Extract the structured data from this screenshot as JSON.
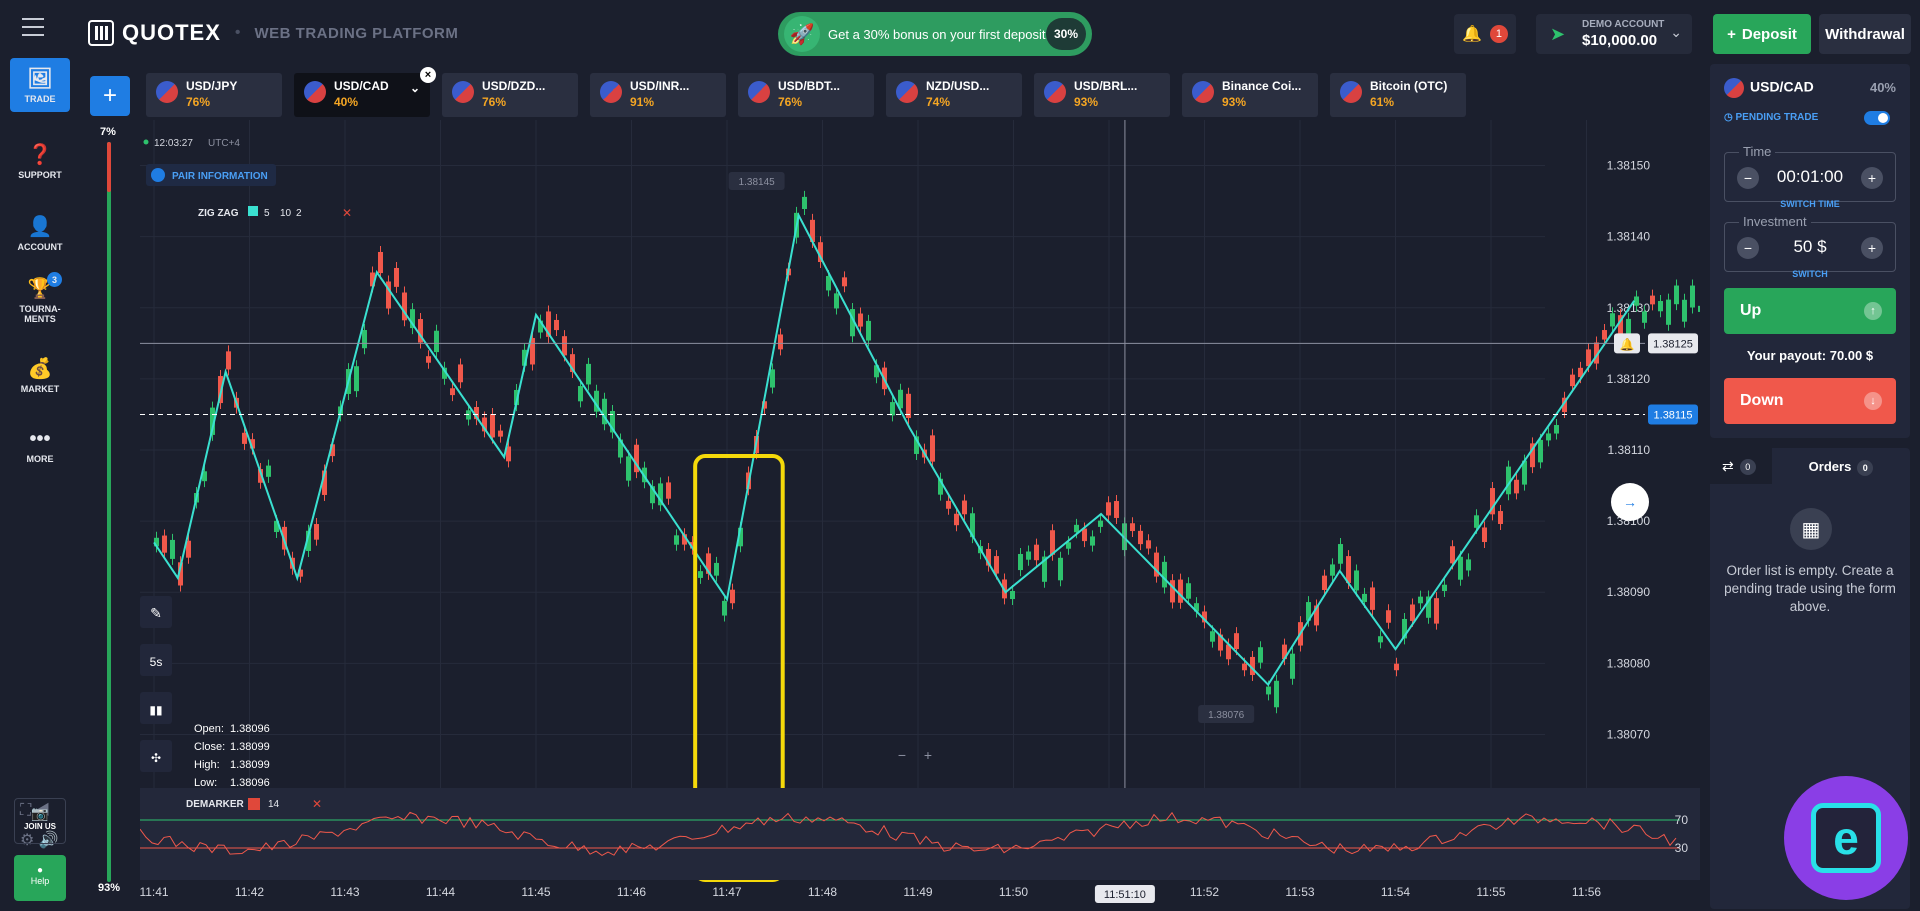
{
  "header": {
    "logo": "QUOTEX",
    "subtitle": "WEB TRADING PLATFORM",
    "bonus_text": "Get a 30% bonus on your first deposit",
    "bonus_pct": "30%",
    "notif_count": "1",
    "account_label": "DEMO ACCOUNT",
    "account_balance": "$10,000.00",
    "deposit": "Deposit",
    "withdrawal": "Withdrawal"
  },
  "sidebar": {
    "items": [
      {
        "label": "TRADE",
        "icon": "chart-icon"
      },
      {
        "label": "SUPPORT",
        "icon": "help-icon"
      },
      {
        "label": "ACCOUNT",
        "icon": "user-icon"
      },
      {
        "label": "TOURNA-MENTS",
        "icon": "trophy-icon",
        "badge": "3"
      },
      {
        "label": "MARKET",
        "icon": "coins-icon"
      },
      {
        "label": "MORE",
        "icon": "dots-icon"
      }
    ],
    "join_label": "JOIN US",
    "help_label": "Help"
  },
  "sentiment": {
    "top": "7%",
    "bottom": "93%",
    "up_fraction": 0.93
  },
  "tabs": [
    {
      "name": "USD/JPY",
      "pct": "76%"
    },
    {
      "name": "USD/CAD",
      "pct": "40%",
      "active": true
    },
    {
      "name": "USD/DZD...",
      "pct": "76%"
    },
    {
      "name": "USD/INR...",
      "pct": "91%"
    },
    {
      "name": "USD/BDT...",
      "pct": "76%"
    },
    {
      "name": "NZD/USD...",
      "pct": "74%"
    },
    {
      "name": "USD/BRL...",
      "pct": "93%"
    },
    {
      "name": "Binance Coi...",
      "pct": "93%"
    },
    {
      "name": "Bitcoin (OTC)",
      "pct": "61%"
    }
  ],
  "chart": {
    "time": "12:03:27",
    "tz": "UTC+4",
    "pair_info": "PAIR INFORMATION",
    "indicator": "ZIG ZAG",
    "indicator_params": [
      "5",
      "10",
      "2"
    ],
    "high_label": "1.38145",
    "low_label": "1.38076",
    "current_price": "1.38115",
    "cursor_price": "1.38125",
    "cursor_time": "11:51:10",
    "timeframe": "5s",
    "ohlc": {
      "open_label": "Open:",
      "open": "1.38096",
      "close_label": "Close:",
      "close": "1.38099",
      "high_label": "High:",
      "high": "1.38099",
      "low_label": "Low:",
      "low": "1.38096"
    },
    "demarker": "DEMARKER",
    "demarker_period": "14",
    "demarker_levels": [
      "70",
      "30"
    ]
  },
  "chart_data": {
    "type": "candlestick",
    "price_ticks": [
      "1.38150",
      "1.38140",
      "1.38130",
      "1.38120",
      "1.38110",
      "1.38100",
      "1.38090",
      "1.38080",
      "1.38070"
    ],
    "time_ticks": [
      "11:41",
      "11:42",
      "11:43",
      "11:44",
      "11:45",
      "11:46",
      "11:47",
      "11:48",
      "11:49",
      "11:50",
      "11:51",
      "11:52",
      "11:53",
      "11:54",
      "11:55",
      "11:56"
    ],
    "ylim": [
      1.38065,
      1.38155
    ],
    "zigzag_points": [
      {
        "t": "11:41",
        "p": 1.38097
      },
      {
        "t": "11:41:15",
        "p": 1.38092
      },
      {
        "t": "11:41:45",
        "p": 1.38121
      },
      {
        "t": "11:42:30",
        "p": 1.38092
      },
      {
        "t": "11:43:20",
        "p": 1.38135
      },
      {
        "t": "11:44:40",
        "p": 1.38109
      },
      {
        "t": "11:45:00",
        "p": 1.38129
      },
      {
        "t": "11:47:00",
        "p": 1.38089
      },
      {
        "t": "11:47:45",
        "p": 1.38143
      },
      {
        "t": "11:48:55",
        "p": 1.38113
      },
      {
        "t": "11:49:55",
        "p": 1.3809
      },
      {
        "t": "11:50:55",
        "p": 1.38101
      },
      {
        "t": "11:52:40",
        "p": 1.38077
      },
      {
        "t": "11:53:25",
        "p": 1.38093
      },
      {
        "t": "11:54:00",
        "p": 1.38082
      },
      {
        "t": "11:56:30",
        "p": 1.38131
      }
    ]
  },
  "panel": {
    "pair": "USD/CAD",
    "pair_pct": "40%",
    "pending": "PENDING TRADE",
    "time_label": "Time",
    "time_value": "00:01:00",
    "switch_time": "SWITCH TIME",
    "investment_label": "Investment",
    "investment_value": "50 $",
    "switch": "SWITCH",
    "up": "Up",
    "payout_label": "Your payout:",
    "payout_value": "70.00 $",
    "down": "Down",
    "orders_count": "0",
    "orders": "Orders",
    "orders_tab_count": "0",
    "empty_text": "Order list is empty. Create a pending trade using the form above."
  }
}
